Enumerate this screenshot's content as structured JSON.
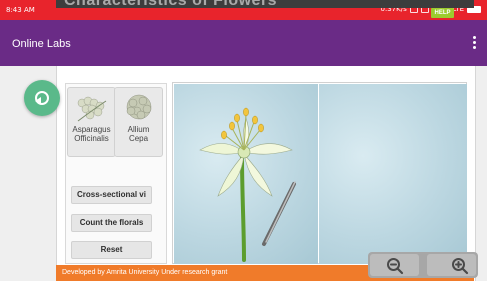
{
  "statusbar": {
    "time": "8:43 AM",
    "speed": "0.37K/s",
    "network": "4G VoLTE"
  },
  "appbar": {
    "title": "Online Labs"
  },
  "lab": {
    "title": "Characteristics of Flowers",
    "help_label": "HELP",
    "thumbnails": [
      {
        "label": "Asparagus\nOfficinalis"
      },
      {
        "label": "Allium\nCepa"
      }
    ],
    "buttons": [
      {
        "label": "Cross-sectional vi"
      },
      {
        "label": "Count the florals"
      },
      {
        "label": "Reset"
      }
    ],
    "footer": "Developed by Amrita University Under research grant"
  },
  "colors": {
    "statusbar": "#e8242c",
    "appbar": "#6a2b86",
    "fab": "#5ab98a",
    "footer": "#f07b2a"
  },
  "icons": {
    "back": "back-icon",
    "menu": "more-vert-icon",
    "zoom_out": "zoom-out-icon",
    "zoom_in": "zoom-in-icon"
  }
}
